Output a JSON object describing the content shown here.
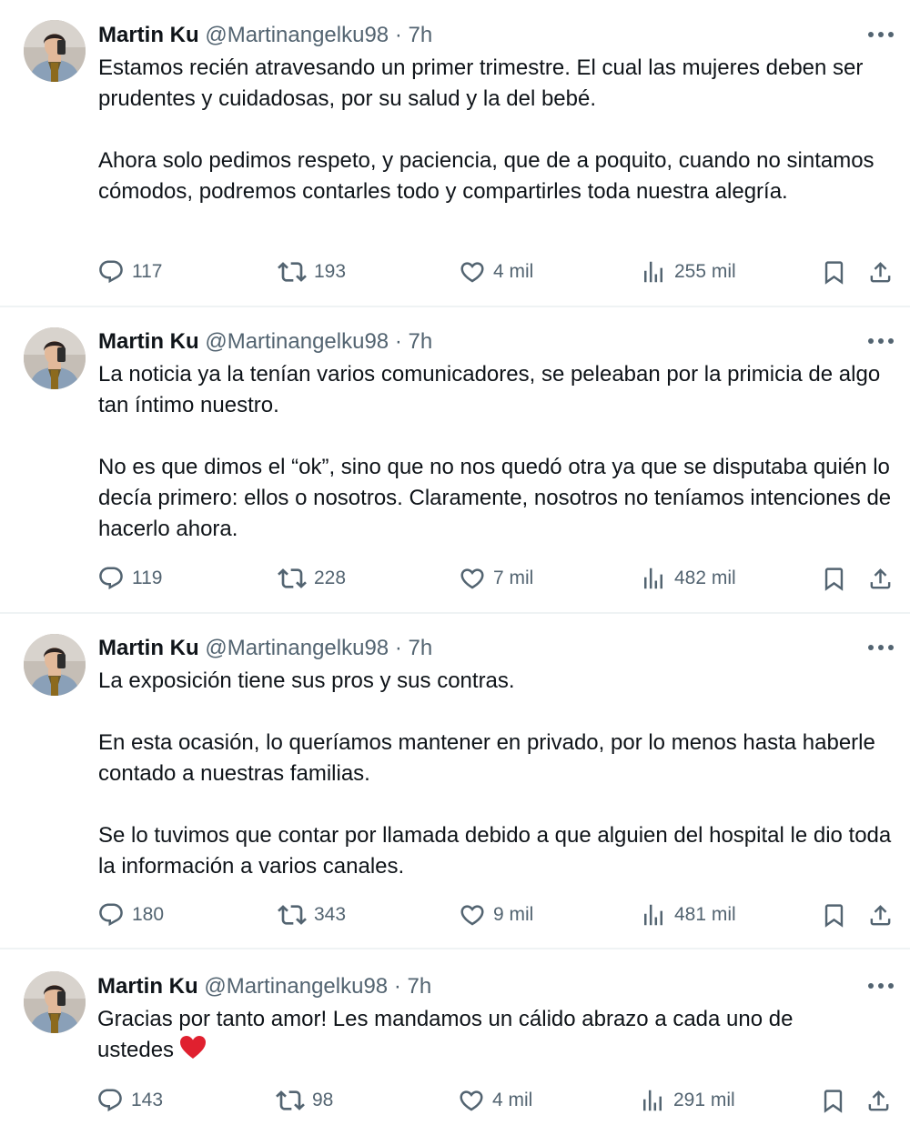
{
  "colors": {
    "text": "#0f1419",
    "secondary": "#536471",
    "divider": "#eff3f4",
    "heart_emoji": "#e0202f"
  },
  "icons": [
    "avatar",
    "more-icon",
    "reply-icon",
    "retweet-icon",
    "like-icon",
    "views-icon",
    "bookmark-icon",
    "share-icon",
    "red-heart-emoji"
  ],
  "tweets": [
    {
      "name": "Martin Ku",
      "meta": "@Martinangelku98 · 7h",
      "paragraphs": [
        "Estamos recién atravesando un primer trimestre. El cual las mujeres deben ser prudentes y cuidadosas, por su salud y la del bebé.",
        "Ahora solo pedimos respeto, y paciencia, que de a poquito, cuando no sintamos cómodos, podremos contarles todo y compartirles toda nuestra alegría."
      ],
      "replies": "117",
      "retweets": "193",
      "likes": "4 mil",
      "views": "255 mil"
    },
    {
      "name": "Martin Ku",
      "meta": "@Martinangelku98 · 7h",
      "paragraphs": [
        "La noticia ya la tenían varios comunicadores, se peleaban por la primicia de algo tan íntimo nuestro.",
        "No es que dimos el “ok”, sino que no nos quedó otra ya que se disputaba quién lo decía primero: ellos o nosotros. Claramente, nosotros no teníamos intenciones de hacerlo ahora."
      ],
      "replies": "119",
      "retweets": "228",
      "likes": "7 mil",
      "views": "482 mil"
    },
    {
      "name": "Martin Ku",
      "meta": "@Martinangelku98 · 7h",
      "paragraphs": [
        "La exposición tiene sus pros y sus contras.",
        "En esta ocasión, lo queríamos mantener en privado, por lo menos hasta haberle contado a nuestras familias.",
        "Se lo tuvimos que contar por llamada debido a que alguien del hospital le dio toda la información a varios canales."
      ],
      "replies": "180",
      "retweets": "343",
      "likes": "9 mil",
      "views": "481 mil"
    },
    {
      "name": "Martin Ku",
      "meta": "@Martinangelku98 · 7h",
      "paragraphs": [
        "Gracias por tanto amor! Les mandamos un cálido abrazo a cada uno de ustedes"
      ],
      "replies": "143",
      "retweets": "98",
      "likes": "4 mil",
      "views": "291 mil"
    }
  ]
}
